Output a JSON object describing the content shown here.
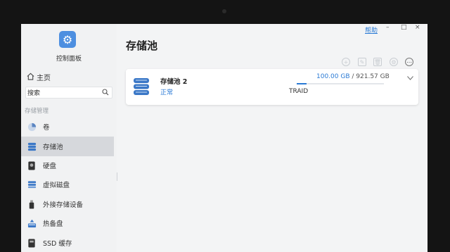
{
  "sidebar": {
    "control_panel_label": "控制面板",
    "home_label": "主页",
    "search_placeholder": "搜索",
    "section_label": "存储管理",
    "items": [
      {
        "label": "卷",
        "icon": "pie-volume-icon",
        "active": false
      },
      {
        "label": "存储池",
        "icon": "storage-pool-icon",
        "active": true
      },
      {
        "label": "硬盘",
        "icon": "hard-disk-icon",
        "active": false
      },
      {
        "label": "虚拟磁盘",
        "icon": "virtual-disk-icon",
        "active": false
      },
      {
        "label": "外接存储设备",
        "icon": "usb-drive-icon",
        "active": false
      },
      {
        "label": "热备盘",
        "icon": "hot-spare-icon",
        "active": false
      },
      {
        "label": "SSD 缓存",
        "icon": "ssd-cache-icon",
        "active": false
      }
    ]
  },
  "header": {
    "title": "存储池",
    "help_label": "帮助",
    "window_controls": [
      "–",
      "□",
      "×"
    ]
  },
  "toolbar": {
    "icons": [
      "add-icon",
      "edit-icon",
      "delete-icon",
      "settings-icon",
      "more-icon"
    ]
  },
  "pool": {
    "name": "存储池 2",
    "status": "正常",
    "used": "100.00 GB",
    "separator": " / ",
    "total": "921.57 GB",
    "usage_fraction": 0.11,
    "raid": "TRAID"
  },
  "colors": {
    "accent": "#2a7ad5",
    "active_bg": "#d6d8dc"
  }
}
